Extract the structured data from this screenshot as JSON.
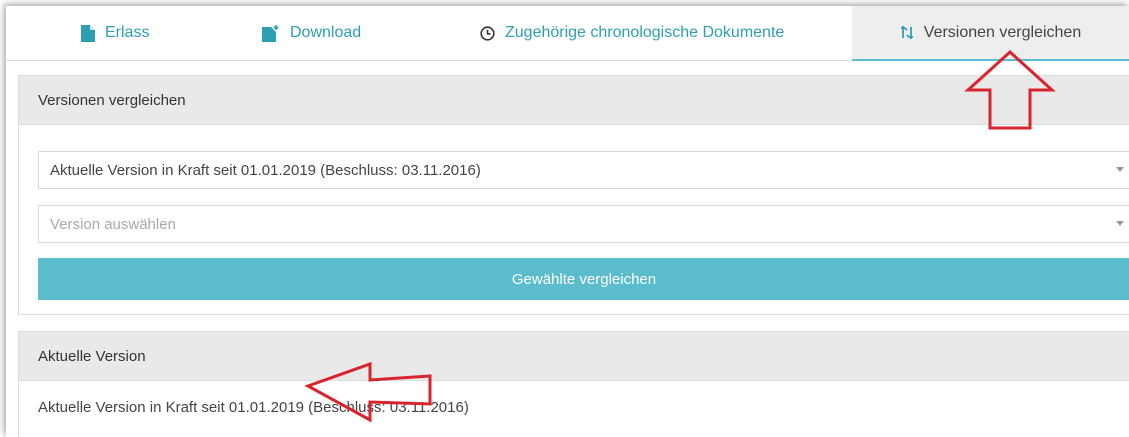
{
  "tabs": [
    {
      "label": "Erlass",
      "icon": "document-icon"
    },
    {
      "label": "Download",
      "icon": "download-document-icon"
    },
    {
      "label": "Zugehörige chronologische Dokumente",
      "icon": "clock-icon"
    },
    {
      "label": "Versionen vergleichen",
      "icon": "compare-icon",
      "active": true
    }
  ],
  "compare_panel": {
    "title": "Versionen vergleichen",
    "current_select_value": "Aktuelle Version in Kraft seit 01.01.2019 (Beschluss: 03.11.2016)",
    "version_select_placeholder": "Version auswählen",
    "compare_button": "Gewählte vergleichen"
  },
  "current_panel": {
    "title": "Aktuelle Version",
    "text": "Aktuelle Version in Kraft seit 01.01.2019 (Beschluss: 03.11.2016)"
  },
  "colors": {
    "accent": "#5bbccd",
    "tab_text": "#2e9fb0",
    "annotation_arrow": "#d9232d"
  }
}
